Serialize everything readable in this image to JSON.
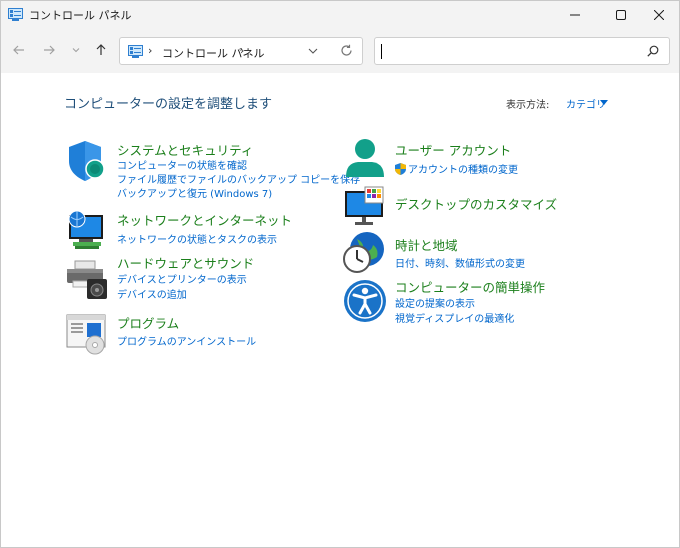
{
  "window": {
    "title": "コントロール パネル",
    "accent": "#1b7f1b",
    "link_color": "#0066cc"
  },
  "address": {
    "separator": "›",
    "path": "コントロール パネル",
    "trailing_separator": "›"
  },
  "search": {
    "value": "",
    "placeholder": ""
  },
  "content": {
    "heading": "コンピューターの設定を調整します",
    "view_by_label": "表示方法:",
    "view_by_value": "カテゴリ"
  },
  "categories": [
    {
      "title": "システムとセキュリティ",
      "icon": "shield-icon",
      "links": [
        "コンピューターの状態を確認",
        "ファイル履歴でファイルのバックアップ コピーを保存",
        "バックアップと復元 (Windows 7)"
      ]
    },
    {
      "title": "ネットワークとインターネット",
      "icon": "network-icon",
      "links": [
        "ネットワークの状態とタスクの表示"
      ]
    },
    {
      "title": "ハードウェアとサウンド",
      "icon": "printer-icon",
      "links": [
        "デバイスとプリンターの表示",
        "デバイスの追加"
      ]
    },
    {
      "title": "プログラム",
      "icon": "programs-icon",
      "links": [
        "プログラムのアンインストール"
      ]
    },
    {
      "title": "ユーザー アカウント",
      "icon": "user-icon",
      "links": [
        "アカウントの種類の変更"
      ]
    },
    {
      "title": "デスクトップのカスタマイズ",
      "icon": "desktop-icon",
      "links": []
    },
    {
      "title": "時計と地域",
      "icon": "clock-globe-icon",
      "links": [
        "日付、時刻、数値形式の変更"
      ]
    },
    {
      "title": "コンピューターの簡単操作",
      "icon": "accessibility-icon",
      "links": [
        "設定の提案の表示",
        "視覚ディスプレイの最適化"
      ]
    }
  ]
}
